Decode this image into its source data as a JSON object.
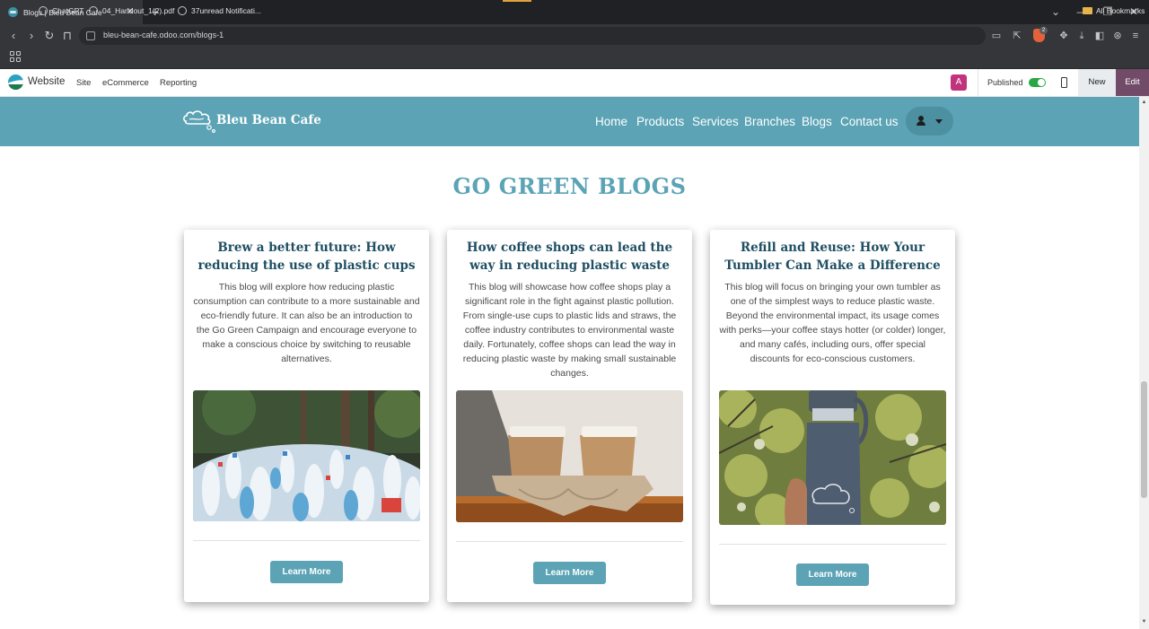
{
  "browser": {
    "tab_title": "Blogs | Bleu Bean Cafe",
    "tab_close": "✕",
    "new_tab": "+",
    "url": "bleu-bean-cafe.odoo.com/blogs-1",
    "brave_badge": "2",
    "bookmarks": [
      {
        "label": "ChatGPT",
        "icon": "globe-icon"
      },
      {
        "label": "04_Handout_1(2).pdf",
        "icon": "globe-icon"
      },
      {
        "label": "37unread Notificati...",
        "icon": "globe-icon"
      }
    ],
    "all_bookmarks": "All Bookmarks"
  },
  "odoo_bar": {
    "app_title": "Website",
    "menu": [
      "Site",
      "eCommerce",
      "Reporting"
    ],
    "avatar_letter": "A",
    "published_label": "Published",
    "published": true,
    "new_label": "New",
    "edit_label": "Edit",
    "accent": "#714b67"
  },
  "site": {
    "brand": "Bleu Bean Cafe",
    "nav": [
      "Home",
      "Products",
      "Services",
      "Branches",
      "Blogs",
      "Contact us"
    ],
    "header_color": "#5ba3b5"
  },
  "page": {
    "title": "GO GREEN BLOGS",
    "cards": [
      {
        "title": "Brew a better future: How reducing the use of plastic cups can make a big",
        "text": "This blog will explore how reducing plastic consumption can contribute to a more sustainable and eco-friendly future. It can also be an introduction to the Go Green Campaign and encourage everyone to make a conscious choice by switching to reusable alternatives.",
        "image": "plastic-bottles-image",
        "button": "Learn More"
      },
      {
        "title": "How coffee shops can lead the way in reducing plastic waste",
        "text": "This blog will showcase how coffee shops play a significant role in the fight against plastic pollution. From single-use cups to plastic lids and straws, the coffee industry contributes to environmental waste daily. Fortunately, coffee shops can lead the way in reducing plastic waste by making small sustainable changes.",
        "image": "coffee-cups-image",
        "button": "Learn More"
      },
      {
        "title": "Refill and Reuse: How Your Tumbler Can Make a Difference",
        "text": "This blog will focus on bringing your own tumbler as one of the simplest ways to reduce plastic waste. Beyond the environmental impact, its usage comes with perks—your coffee stays hotter (or colder) longer, and many cafés, including ours, offer special discounts for eco-conscious customers.",
        "image": "tumbler-image",
        "button": "Learn More"
      }
    ]
  }
}
